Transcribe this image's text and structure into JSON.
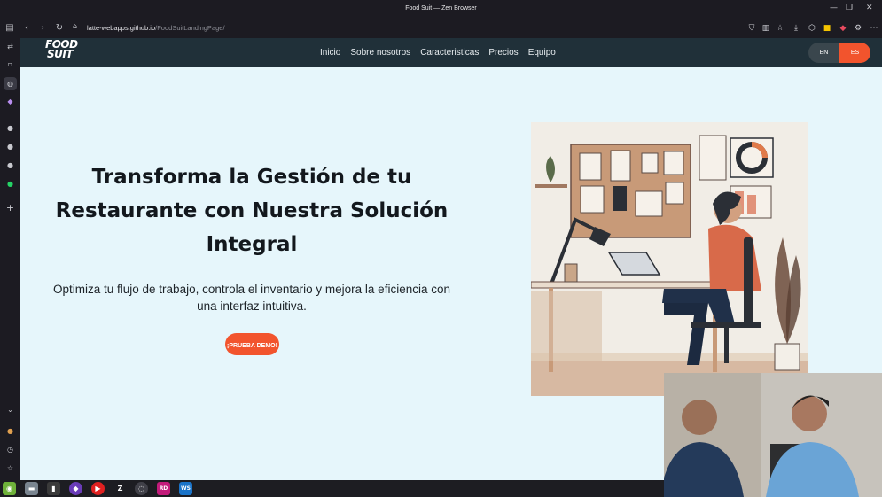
{
  "window": {
    "title": "Food Suit — Zen Browser",
    "controls": [
      "minimize-icon",
      "maximize-icon",
      "close-icon"
    ]
  },
  "browser": {
    "url_host": "latte-webapps.github.io",
    "url_path": "/FoodSuitLandingPage/",
    "nav_icons": [
      "sidebar-toggle-icon",
      "back-icon",
      "forward-icon",
      "reload-icon",
      "site-info-icon"
    ],
    "toolbar_icons": [
      "shield-icon",
      "reader-icon",
      "bookmark-star-icon",
      "download-icon",
      "extensions-icon",
      "edit-icon",
      "colors-icon",
      "extension-icon",
      "settings-icon",
      "menu-icon"
    ]
  },
  "sidebar": {
    "icons": [
      "swap-icon",
      "tab-icon",
      "globe-icon",
      "extension-gem-icon",
      "github-icon",
      "github-icon",
      "github-icon",
      "whatsapp-icon",
      "plus-icon"
    ],
    "bottom_icons": [
      "chevron-down-icon",
      "avatar-icon",
      "history-icon",
      "star-icon"
    ]
  },
  "site": {
    "logo_line1": "FOOD",
    "logo_line2": "SUIT",
    "menu": [
      "Inicio",
      "Sobre nosotros",
      "Caracteristicas",
      "Precios",
      "Equipo"
    ],
    "lang_en": "EN",
    "lang_es": "ES",
    "active_lang": "ES",
    "brand_color": "#f2542d",
    "nav_color": "#203039"
  },
  "hero": {
    "title": "Transforma la Gestión de tu Restaurante con Nuestra Solución Integral",
    "subtitle": "Optimiza tu flujo de trabajo, controla el inventario y mejora la eficiencia con una interfaz intuitiva.",
    "cta_label": "¡PRUEBA DEMO!"
  },
  "taskbar": {
    "apps": [
      "mint-menu-icon",
      "files-icon",
      "terminal-icon",
      "app-purple-icon",
      "youtube-music-icon",
      "zed-icon",
      "obs-icon",
      "rider-icon",
      "webstorm-icon"
    ],
    "rider_label": "RD",
    "webstorm_label": "WS"
  }
}
